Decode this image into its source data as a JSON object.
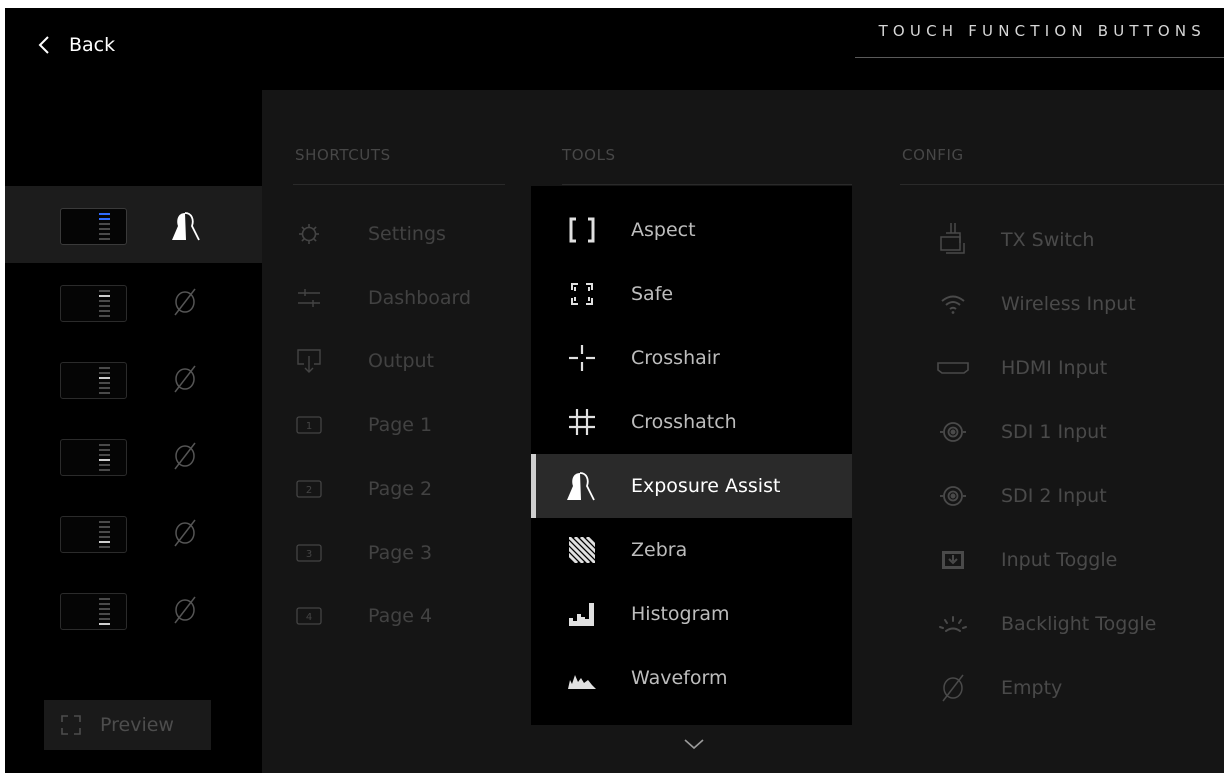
{
  "header": {
    "back_label": "Back",
    "title": "TOUCH FUNCTION BUTTONS"
  },
  "slots": [
    {
      "function_icon": "exposure-assist-icon",
      "active": true
    },
    {
      "function_icon": "empty-icon",
      "active": false
    },
    {
      "function_icon": "empty-icon",
      "active": false
    },
    {
      "function_icon": "empty-icon",
      "active": false
    },
    {
      "function_icon": "empty-icon",
      "active": false
    },
    {
      "function_icon": "empty-icon",
      "active": false
    }
  ],
  "preview": {
    "label": "Preview"
  },
  "columns": {
    "shortcuts": {
      "heading": "SHORTCUTS",
      "items": [
        {
          "label": "Settings",
          "icon": "gear-icon"
        },
        {
          "label": "Dashboard",
          "icon": "sliders-icon"
        },
        {
          "label": "Output",
          "icon": "output-icon"
        },
        {
          "label": "Page 1",
          "icon": "page-1-icon",
          "num": "1"
        },
        {
          "label": "Page 2",
          "icon": "page-2-icon",
          "num": "2"
        },
        {
          "label": "Page 3",
          "icon": "page-3-icon",
          "num": "3"
        },
        {
          "label": "Page 4",
          "icon": "page-4-icon",
          "num": "4"
        }
      ]
    },
    "tools": {
      "heading": "TOOLS",
      "selected": "Exposure Assist",
      "items": [
        {
          "label": "Aspect",
          "icon": "aspect-icon"
        },
        {
          "label": "Safe",
          "icon": "safe-icon"
        },
        {
          "label": "Crosshair",
          "icon": "crosshair-icon"
        },
        {
          "label": "Crosshatch",
          "icon": "crosshatch-icon"
        },
        {
          "label": "Exposure Assist",
          "icon": "exposure-assist-icon"
        },
        {
          "label": "Zebra",
          "icon": "zebra-icon"
        },
        {
          "label": "Histogram",
          "icon": "histogram-icon"
        },
        {
          "label": "Waveform",
          "icon": "waveform-icon"
        }
      ]
    },
    "config": {
      "heading": "CONFIG",
      "items": [
        {
          "label": "TX Switch",
          "icon": "tx-switch-icon"
        },
        {
          "label": "Wireless Input",
          "icon": "wifi-icon"
        },
        {
          "label": "HDMI Input",
          "icon": "hdmi-icon"
        },
        {
          "label": "SDI 1 Input",
          "icon": "sdi-icon"
        },
        {
          "label": "SDI 2 Input",
          "icon": "sdi-icon"
        },
        {
          "label": "Input Toggle",
          "icon": "input-toggle-icon"
        },
        {
          "label": "Backlight Toggle",
          "icon": "backlight-icon"
        },
        {
          "label": "Empty",
          "icon": "empty-icon"
        }
      ]
    }
  }
}
